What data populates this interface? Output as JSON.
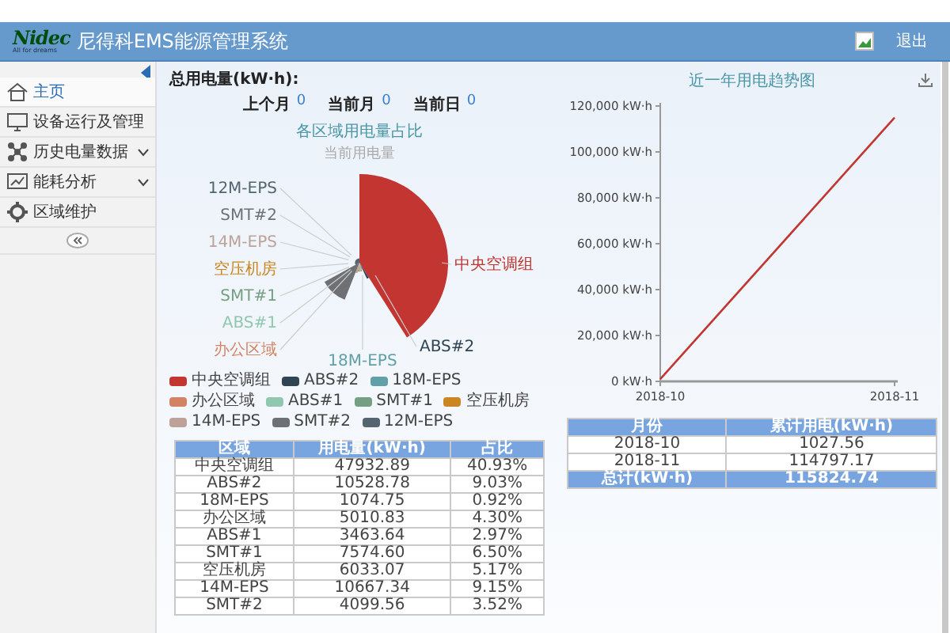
{
  "header": {
    "brand": "Nidec",
    "tagline": "All for dreams",
    "title": "尼得科EMS能源管理系统",
    "logout": "退出"
  },
  "sidebar": {
    "items": [
      {
        "label": "主页",
        "selected": true,
        "expandable": false
      },
      {
        "label": "设备运行及管理",
        "selected": false,
        "expandable": false
      },
      {
        "label": "历史电量数据",
        "selected": false,
        "expandable": true
      },
      {
        "label": "能耗分析",
        "selected": false,
        "expandable": true
      },
      {
        "label": "区域维护",
        "selected": false,
        "expandable": false
      }
    ]
  },
  "summary": {
    "label": "总用电量(kW·h):",
    "stats": [
      {
        "label": "上个月",
        "value": "0"
      },
      {
        "label": "当前月",
        "value": "0"
      },
      {
        "label": "当前日",
        "value": "0"
      }
    ]
  },
  "pie": {
    "title": "各区域用电量占比",
    "subtitle": "当前用电量",
    "labels": [
      {
        "text": "12M-EPS",
        "color": "#546570"
      },
      {
        "text": "SMT#2",
        "color": "#6e7074"
      },
      {
        "text": "中央空调组",
        "color": "#c23531"
      },
      {
        "text": "14M-EPS",
        "color": "#bda29a"
      },
      {
        "text": "空压机房",
        "color": "#ca8622"
      },
      {
        "text": "SMT#1",
        "color": "#749f83"
      },
      {
        "text": "ABS#1",
        "color": "#91c7ae"
      },
      {
        "text": "办公区域",
        "color": "#d48265"
      },
      {
        "text": "18M-EPS",
        "color": "#61a0a8"
      },
      {
        "text": "ABS#2",
        "color": "#2f4554"
      }
    ],
    "legend": [
      {
        "label": "中央空调组",
        "color": "#c23531"
      },
      {
        "label": "ABS#2",
        "color": "#2f4554"
      },
      {
        "label": "18M-EPS",
        "color": "#61a0a8"
      },
      {
        "label": "办公区域",
        "color": "#d48265"
      },
      {
        "label": "ABS#1",
        "color": "#91c7ae"
      },
      {
        "label": "SMT#1",
        "color": "#749f83"
      },
      {
        "label": "空压机房",
        "color": "#ca8622"
      },
      {
        "label": "14M-EPS",
        "color": "#bda29a"
      },
      {
        "label": "SMT#2",
        "color": "#6e7074"
      },
      {
        "label": "12M-EPS",
        "color": "#546570"
      }
    ]
  },
  "area_table": {
    "columns": [
      "区域",
      "用电量(kW·h)",
      "占比"
    ],
    "rows": [
      [
        "中央空调组",
        "47932.89",
        "40.93%"
      ],
      [
        "ABS#2",
        "10528.78",
        "9.03%"
      ],
      [
        "18M-EPS",
        "1074.75",
        "0.92%"
      ],
      [
        "办公区域",
        "5010.83",
        "4.30%"
      ],
      [
        "ABS#1",
        "3463.64",
        "2.97%"
      ],
      [
        "SMT#1",
        "7574.60",
        "6.50%"
      ],
      [
        "空压机房",
        "6033.07",
        "5.17%"
      ],
      [
        "14M-EPS",
        "10667.34",
        "9.15%"
      ],
      [
        "SMT#2",
        "4099.56",
        "3.52%"
      ]
    ]
  },
  "trend": {
    "chart_data": {
      "type": "line",
      "title": "近一年用电趋势图",
      "categories": [
        "2018-10",
        "2018-11"
      ],
      "series": [
        {
          "color": "#c23531",
          "values": [
            1000,
            115000
          ]
        }
      ],
      "ylim": [
        0,
        120000
      ],
      "yticks": [
        {
          "value": 0,
          "label": "0 kW·h"
        },
        {
          "value": 20000,
          "label": "20,000 kW·h"
        },
        {
          "value": 40000,
          "label": "40,000 kW·h"
        },
        {
          "value": 60000,
          "label": "60,000 kW·h"
        },
        {
          "value": 80000,
          "label": "80,000 kW·h"
        },
        {
          "value": 100000,
          "label": "100,000 kW·h"
        },
        {
          "value": 120000,
          "label": "120,000 kW·h"
        }
      ]
    }
  },
  "month_table": {
    "columns": [
      "月份",
      "累计用电(kW·h)"
    ],
    "rows": [
      [
        "2018-10",
        "1027.56"
      ],
      [
        "2018-11",
        "114797.17"
      ]
    ],
    "footer": [
      "总计(kW·h)",
      "115824.74"
    ]
  }
}
